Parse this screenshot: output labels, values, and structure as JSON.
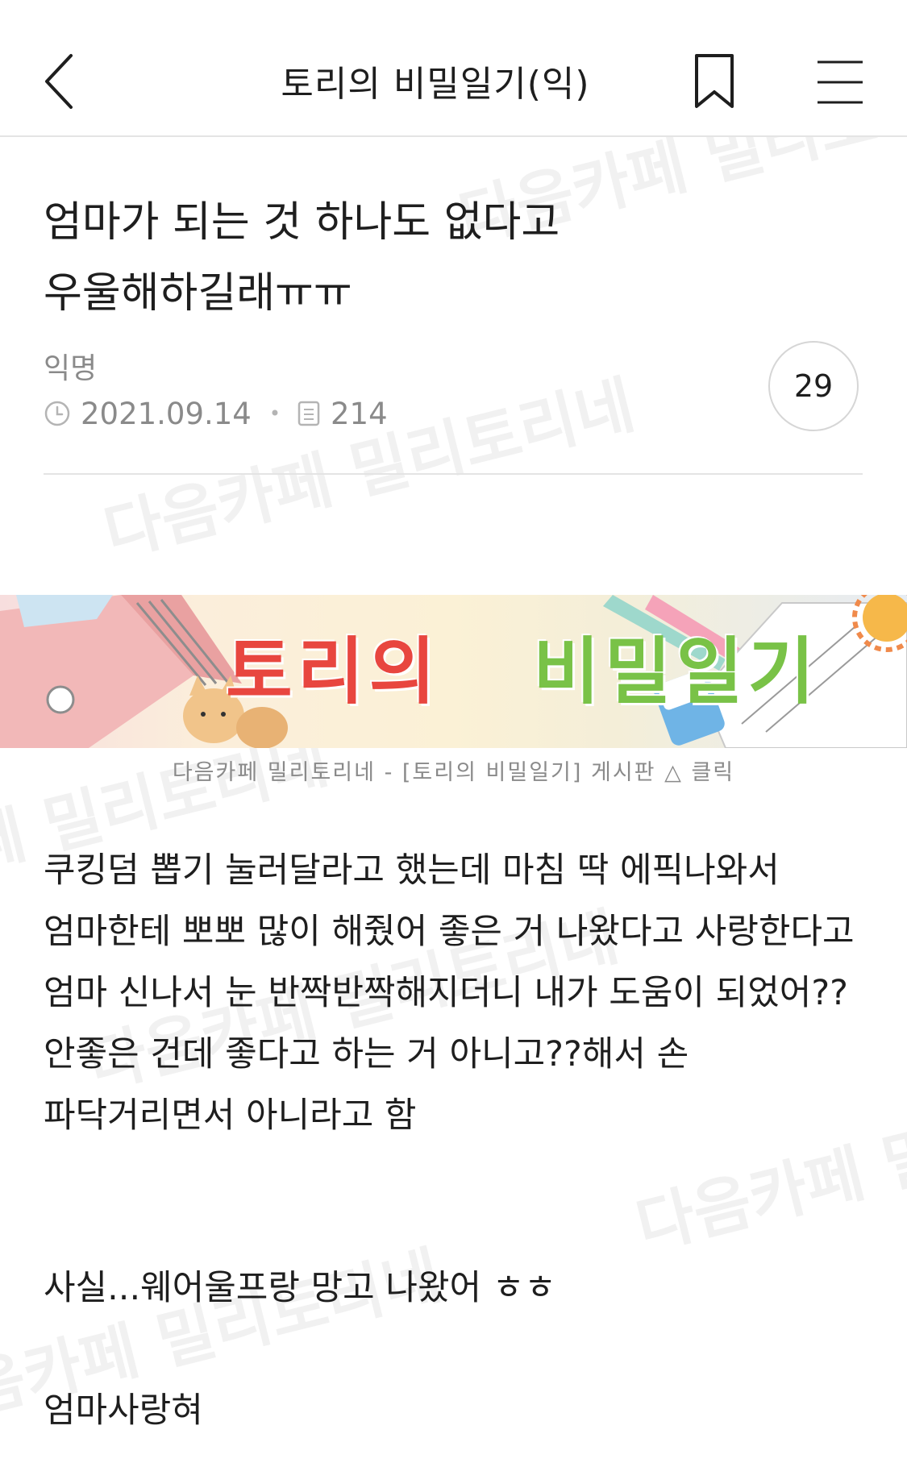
{
  "header": {
    "title": "토리의 비밀일기(익)",
    "icons": [
      "back-icon",
      "bookmark-icon",
      "menu-icon"
    ]
  },
  "post": {
    "title": "엄마가 되는 것 하나도 없다고 우울해하길래ㅠㅠ",
    "author": "익명",
    "date": "2021.09.14",
    "views": "214",
    "comment_count": "29"
  },
  "banner": {
    "title_part1": "토리의",
    "title_part2": "비밀일기",
    "caption": "다음카페 밀리토리네 - [토리의 비밀일기] 게시판 △ 클릭"
  },
  "body": {
    "paragraph1": "쿠킹덤 뽑기 눌러달라고 했는데 마침 딱 에픽나와서 엄마한테 뽀뽀 많이 해줬어 좋은 거 나왔다고 사랑한다고 엄마 신나서 눈 반짝반짝해지더니 내가 도움이 되었어?? 안좋은 건데 좋다고 하는 거 아니고??해서 손 파닥거리면서 아니라고 함",
    "paragraph2": "사실...웨어울프랑 망고 나왔어 ㅎㅎ",
    "paragraph3": "엄마사랑혀"
  },
  "watermark": {
    "text": "다음카페 밀리토리네"
  },
  "colors": {
    "text": "#1e1e1e",
    "muted": "#8a8a8a",
    "divider": "#e4e4e4"
  }
}
